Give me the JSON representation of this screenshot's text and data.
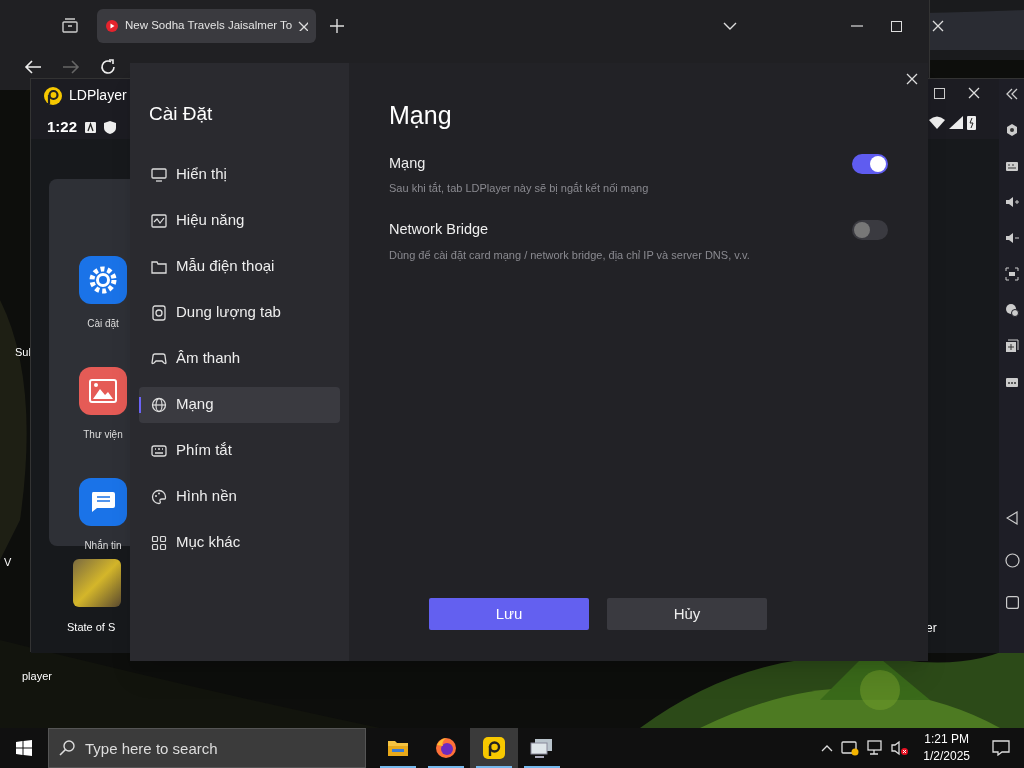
{
  "browser": {
    "tab": {
      "title": "New Sodha Travels Jaisalmer To"
    }
  },
  "emulator": {
    "title": "LDPlayer",
    "clock": "1:22",
    "apps": [
      {
        "label": "Cài đặt"
      },
      {
        "label": "Thư viện"
      },
      {
        "label": "Nhắn tin"
      }
    ],
    "game": {
      "label": "State of S"
    },
    "edge_label": "er"
  },
  "desktop": {
    "labels": [
      "Sul",
      "V",
      "player"
    ]
  },
  "settings": {
    "title": "Cài Đặt",
    "menu": [
      {
        "label": "Hiển thị",
        "selected": false
      },
      {
        "label": "Hiệu năng",
        "selected": false
      },
      {
        "label": "Mẫu điện thoại",
        "selected": false
      },
      {
        "label": "Dung lượng tab",
        "selected": false
      },
      {
        "label": "Âm thanh",
        "selected": false
      },
      {
        "label": "Mạng",
        "selected": true
      },
      {
        "label": "Phím tắt",
        "selected": false
      },
      {
        "label": "Hình nền",
        "selected": false
      },
      {
        "label": "Mục khác",
        "selected": false
      }
    ],
    "page_title": "Mạng",
    "options": [
      {
        "label": "Mạng",
        "description": "Sau khi tắt, tab LDPlayer này sẽ bị ngắt kết nối mạng",
        "on": true
      },
      {
        "label": "Network Bridge",
        "description": "Dùng để cài đặt card mạng / network bridge, địa chỉ IP và server DNS, v.v.",
        "on": false
      }
    ],
    "buttons": [
      {
        "label": "Lưu",
        "kind": "primary"
      },
      {
        "label": "Hủy",
        "kind": "secondary"
      }
    ]
  },
  "taskbar": {
    "search_placeholder": "Type here to search",
    "time": "1:21 PM",
    "date": "1/2/2025",
    "apps": [
      {
        "selected": false
      },
      {
        "selected": false
      },
      {
        "selected": true
      },
      {
        "selected": false
      }
    ]
  }
}
